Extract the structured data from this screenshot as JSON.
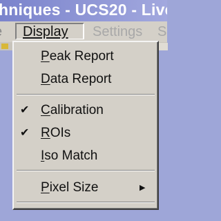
{
  "window": {
    "title": "hniques - UCS20 - Live"
  },
  "menubar": {
    "items": [
      {
        "label": "e"
      },
      {
        "label": "Display"
      },
      {
        "label": "Settings"
      },
      {
        "label": "S"
      }
    ]
  },
  "menu": {
    "items": [
      {
        "pre": "",
        "accel": "P",
        "post": "eak Report",
        "checked": false
      },
      {
        "pre": "",
        "accel": "D",
        "post": "ata Report",
        "checked": false
      },
      {
        "pre": "",
        "accel": "C",
        "post": "alibration",
        "checked": true
      },
      {
        "pre": "",
        "accel": "R",
        "post": "OIs",
        "checked": true
      },
      {
        "pre": "",
        "accel": "I",
        "post": "so Match",
        "checked": false
      },
      {
        "pre": "",
        "accel": "P",
        "post": "ixel Size",
        "checked": false,
        "submenu": true
      }
    ]
  },
  "icons": {
    "check": "checkmark-icon",
    "submenu": "submenu-arrow-icon"
  },
  "colors": {
    "title_bar": "#7a83cc",
    "menu_face": "#d4d0c8",
    "background": "#9ea6d8"
  }
}
